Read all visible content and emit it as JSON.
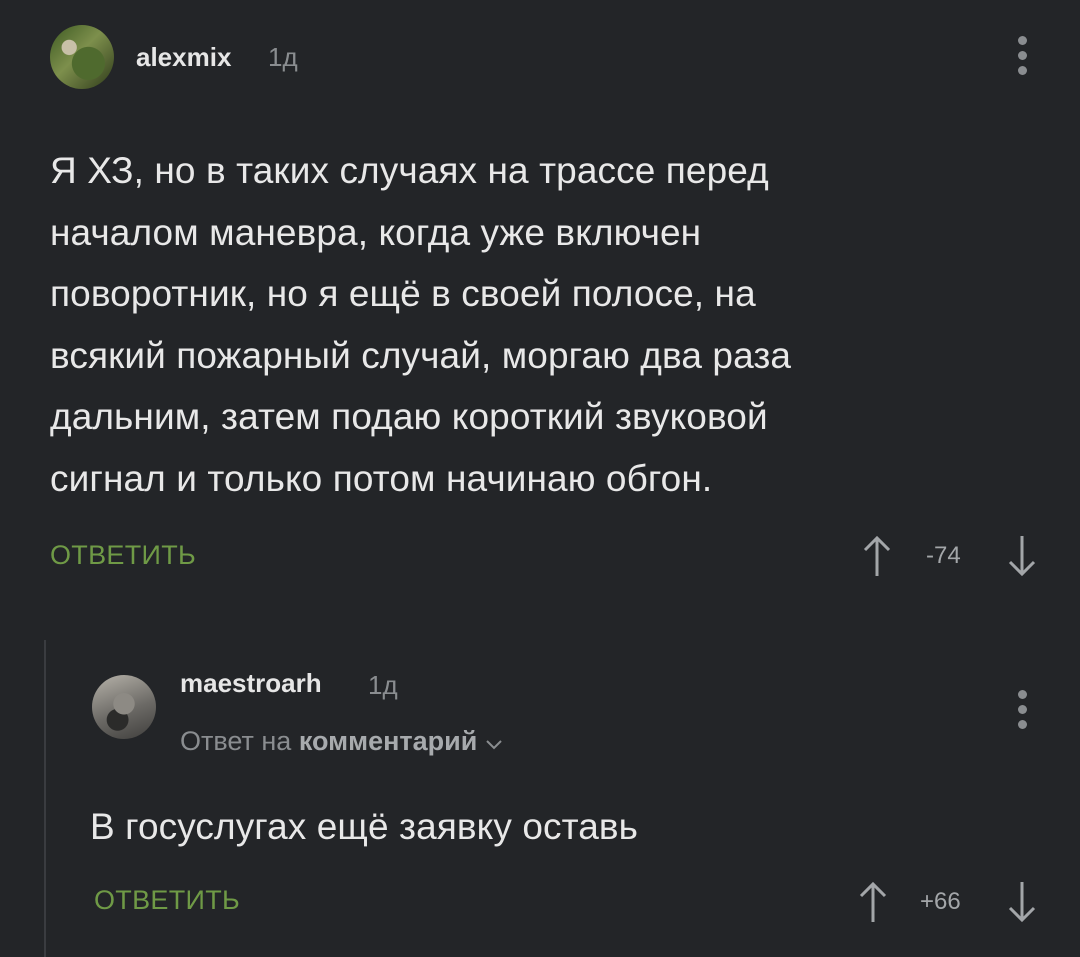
{
  "comments": [
    {
      "username": "alexmix",
      "time": "1д",
      "text_lines": [
        "Я ХЗ, но в таких случаях на трассе перед",
        "началом маневра, когда уже включен",
        "поворотник, но я ещё в своей полосе, на",
        "всякий пожарный случай, моргаю два раза",
        "дальним, затем подаю короткий звуковой",
        "сигнал и только потом начинаю обгон."
      ],
      "reply_label": "ОТВЕТИТЬ",
      "score": "-74"
    },
    {
      "username": "maestroarh",
      "time": "1д",
      "reply_to_prefix": "Ответ на",
      "reply_to_target": "комментарий",
      "text": "В госуслугах ещё заявку оставь",
      "reply_label": "ОТВЕТИТЬ",
      "score": "+66"
    }
  ],
  "icons": {
    "menu": "more-vertical-icon",
    "upvote": "arrow-up-icon",
    "downvote": "arrow-down-icon",
    "reply_expand": "chevron-down-icon"
  },
  "colors": {
    "background": "#232528",
    "accent_green": "#6f9a46",
    "muted": "#8a8d90"
  }
}
